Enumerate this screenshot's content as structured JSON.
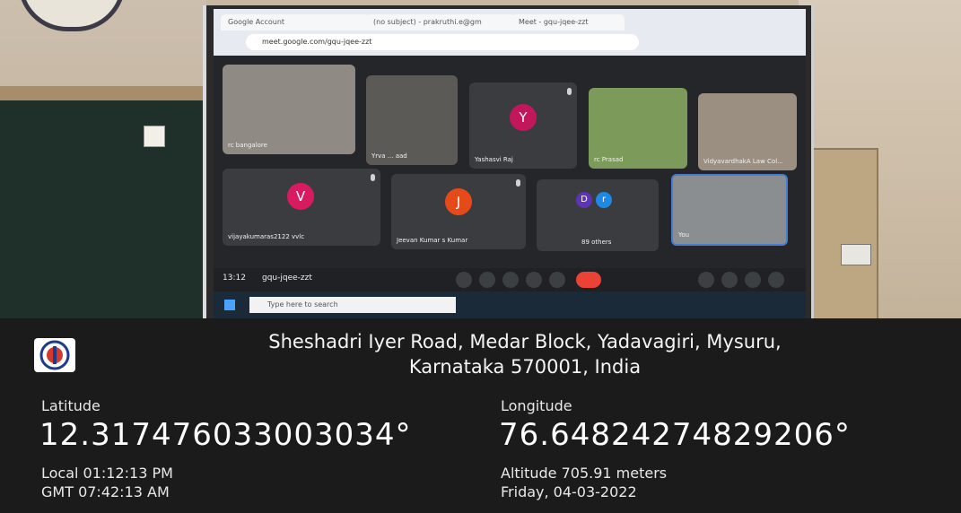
{
  "screen": {
    "tab_1": "Google Account",
    "tab_2": "(no subject) - prakruthi.e@gm",
    "tab_3": "Meet - gqu-jqee-zzt",
    "url": "meet.google.com/gqu-jqee-zzt",
    "participants": [
      {
        "name": "rc bangalore"
      },
      {
        "name": "Yrva ... aad"
      },
      {
        "name": "Yashasvi Raj",
        "initial": "Y",
        "color": "#c2185b"
      },
      {
        "name": "rc Prasad"
      },
      {
        "name": "VidyavardhakA Law Col..."
      },
      {
        "name": "vijayakumaras2122 vvlc",
        "initial": "V",
        "color": "#d81b60"
      },
      {
        "name": "Jeevan Kumar s Kumar",
        "initial": "J",
        "color": "#e64a19"
      },
      {
        "name": "89 others",
        "initial_1": "D",
        "initial_2": "r"
      },
      {
        "name": "You"
      }
    ],
    "meeting_time": "13:12",
    "meeting_code": "gqu-jqee-zzt",
    "taskbar_search": "Type here to search"
  },
  "overlay": {
    "address_line_1": "Sheshadri Iyer Road, Medar Block, Yadavagiri, Mysuru,",
    "address_line_2": "Karnataka 570001, India",
    "latitude_label": "Latitude",
    "latitude_value": "12.317476033003034°",
    "longitude_label": "Longitude",
    "longitude_value": "76.64824274829206°",
    "local_time": "Local 01:12:13 PM",
    "gmt_time": "GMT 07:42:13 AM",
    "altitude": "Altitude 705.91 meters",
    "date": "Friday, 04-03-2022"
  }
}
